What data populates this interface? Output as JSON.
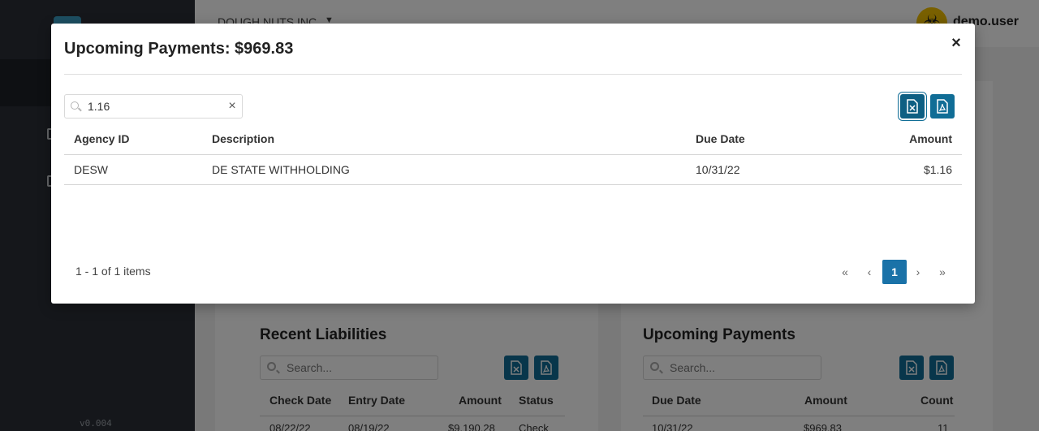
{
  "app": {
    "company": "DOUGH NUTS INC.",
    "user_name": "demo.user",
    "version": "v0.004",
    "user_avatar_icon": "biohazard-icon"
  },
  "background": {
    "recent_liabilities": {
      "title": "Recent Liabilities",
      "search_placeholder": "Search...",
      "columns": [
        "Check Date",
        "Entry Date",
        "Amount",
        "Status"
      ],
      "first_row": [
        "08/22/22",
        "08/19/22",
        "$9,190.28",
        "Check"
      ]
    },
    "upcoming_payments": {
      "title": "Upcoming Payments",
      "search_placeholder": "Search...",
      "columns": [
        "Due Date",
        "Amount",
        "Count"
      ],
      "first_row": [
        "10/31/22",
        "$969.83",
        "11"
      ]
    }
  },
  "modal": {
    "title": "Upcoming Payments: $969.83",
    "close_label": "×",
    "search_value": "1.16",
    "clear_label": "×",
    "columns": {
      "agency_id": "Agency ID",
      "description": "Description",
      "due_date": "Due Date",
      "amount": "Amount"
    },
    "rows": [
      {
        "agency_id": "DESW",
        "description": "DE STATE WITHHOLDING",
        "due_date": "10/31/22",
        "amount": "$1.16"
      }
    ],
    "item_count": "1 - 1 of 1 items",
    "pager": {
      "current_page": "1",
      "first": "«",
      "prev": "‹",
      "next": "›",
      "last": "»"
    }
  },
  "colors": {
    "accent": "#106d96",
    "page_active": "#1a72a8"
  }
}
